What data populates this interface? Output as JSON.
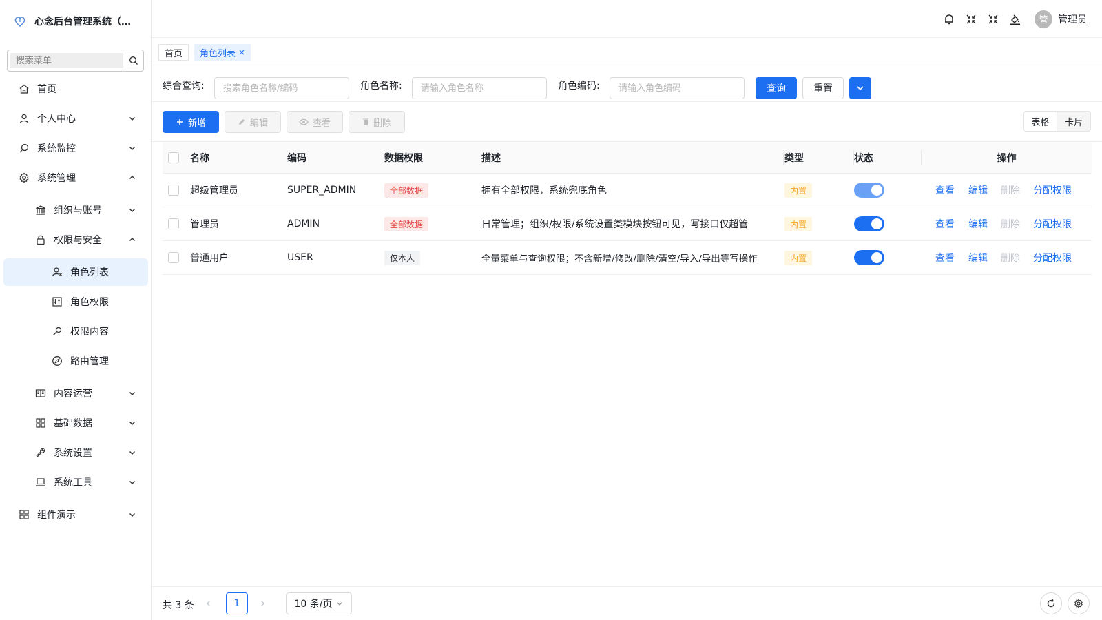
{
  "app": {
    "title": "心念后台管理系统（R...",
    "search_placeholder": "搜索菜单"
  },
  "sidebar": {
    "items": [
      {
        "label": "首页",
        "icon": "home-icon"
      },
      {
        "label": "个人中心",
        "icon": "user-icon"
      },
      {
        "label": "系统监控",
        "icon": "monitor-icon"
      },
      {
        "label": "系统管理",
        "icon": "gear-icon"
      },
      {
        "label": "组织与账号",
        "icon": "bank-icon"
      },
      {
        "label": "权限与安全",
        "icon": "lock-icon"
      },
      {
        "label": "角色列表",
        "icon": "role-icon"
      },
      {
        "label": "角色权限",
        "icon": "sliders-icon"
      },
      {
        "label": "权限内容",
        "icon": "key-icon"
      },
      {
        "label": "路由管理",
        "icon": "compass-icon"
      },
      {
        "label": "内容运营",
        "icon": "book-icon"
      },
      {
        "label": "基础数据",
        "icon": "grid-icon"
      },
      {
        "label": "系统设置",
        "icon": "wrench-icon"
      },
      {
        "label": "系统工具",
        "icon": "laptop-icon"
      },
      {
        "label": "组件演示",
        "icon": "apps-icon"
      }
    ]
  },
  "header": {
    "user_name": "管理员",
    "avatar_text": "管"
  },
  "tabs": {
    "home": "首页",
    "current": "角色列表",
    "close": "×"
  },
  "query": {
    "general_label": "综合查询:",
    "general_placeholder": "搜索角色名称/编码",
    "name_label": "角色名称:",
    "name_placeholder": "请输入角色名称",
    "code_label": "角色编码:",
    "code_placeholder": "请输入角色编码",
    "search_btn": "查询",
    "reset_btn": "重置"
  },
  "toolbar": {
    "add": "新增",
    "edit": "编辑",
    "view": "查看",
    "delete": "删除",
    "view_table": "表格",
    "view_card": "卡片"
  },
  "table": {
    "headers": {
      "name": "名称",
      "code": "编码",
      "scope": "数据权限",
      "desc": "描述",
      "type": "类型",
      "status": "状态",
      "ops": "操作"
    },
    "rows": [
      {
        "name": "超级管理员",
        "code": "SUPER_ADMIN",
        "scope": "全部数据",
        "desc": "拥有全部权限，系统兜底角色",
        "type": "内置",
        "status": true
      },
      {
        "name": "管理员",
        "code": "ADMIN",
        "scope": "全部数据",
        "desc": "日常管理；组织/权限/系统设置类模块按钮可见，写接口仅超管",
        "type": "内置",
        "status": true
      },
      {
        "name": "普通用户",
        "code": "USER",
        "scope": "仅本人",
        "desc": "全量菜单与查询权限；不含新增/修改/删除/清空/导入/导出等写操作",
        "type": "内置",
        "status": true
      }
    ],
    "ops": {
      "view": "查看",
      "edit": "编辑",
      "delete": "删除",
      "assign": "分配权限"
    }
  },
  "footer": {
    "total": "共 3 条",
    "page": "1",
    "page_size": "10 条/页"
  },
  "colors": {
    "primary": "#1d6ff2",
    "danger_tag": "#e44848",
    "warning_tag": "#f5a623"
  }
}
